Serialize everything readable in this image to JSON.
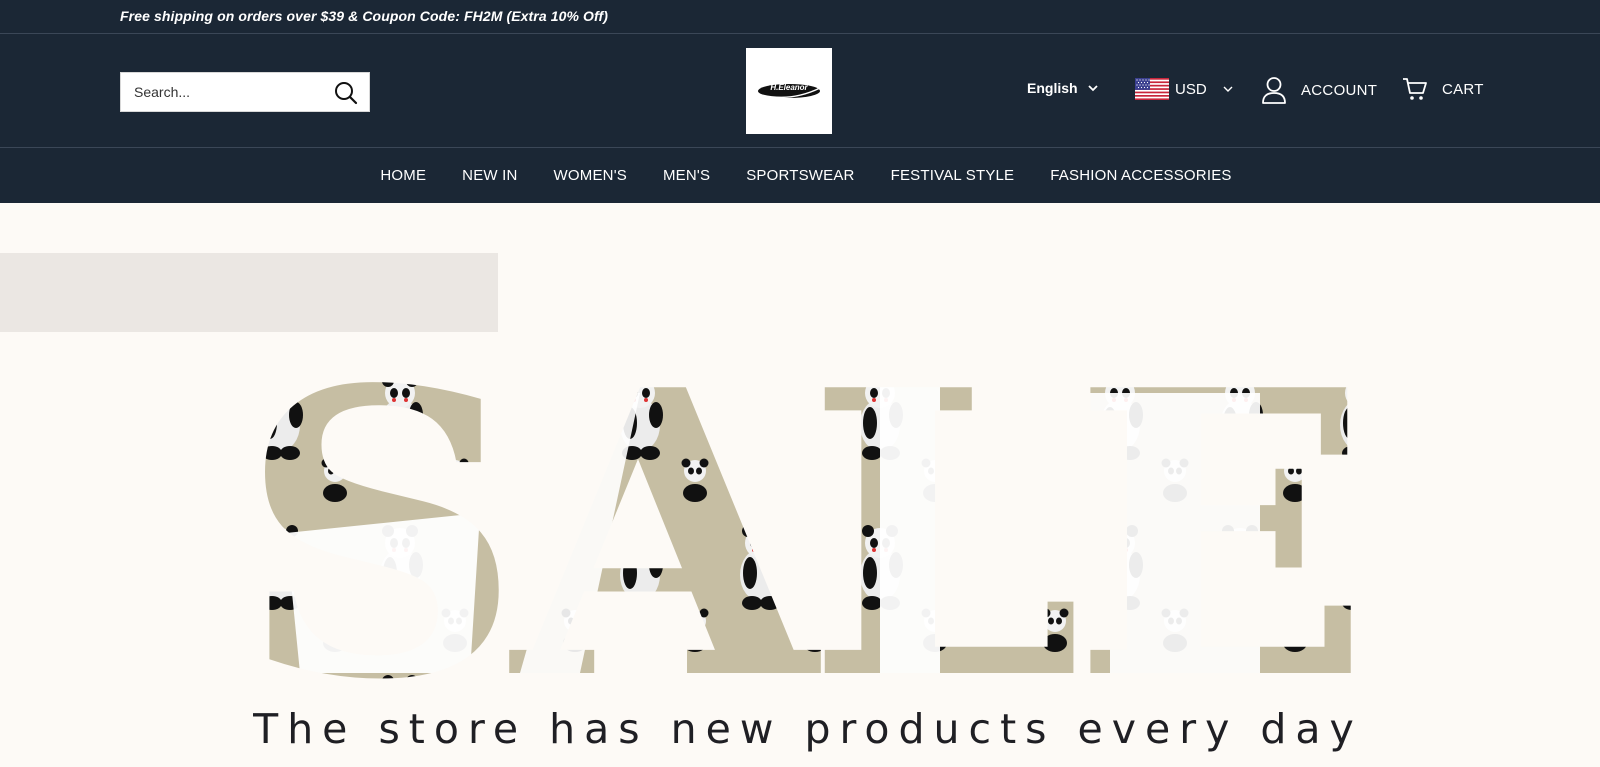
{
  "announcement": {
    "text": "Free shipping on orders over $39 & Coupon Code: FH2M (Extra 10% Off)"
  },
  "header": {
    "search_placeholder": "Search...",
    "logo_text": "H.Eleanor",
    "language": "English",
    "currency": "USD",
    "account_label": "ACCOUNT",
    "cart_label": "CART"
  },
  "nav": {
    "items": [
      "HOME",
      "NEW IN",
      "WOMEN'S",
      "MEN'S",
      "SPORTSWEAR",
      "FESTIVAL STYLE",
      "FASHION ACCESSORIES"
    ]
  },
  "hero": {
    "headline": "SALE",
    "tagline": "The store has new products every day"
  },
  "colors": {
    "header_bg": "#1b2735",
    "hero_bg": "#fdfaf6",
    "hero_band": "#ebe7e3",
    "letter_fill": "#c6bea3"
  },
  "icons": {
    "search": "search-icon",
    "chevron": "chevron-down-icon",
    "flag": "us-flag-icon",
    "account": "user-icon",
    "cart": "cart-icon"
  }
}
